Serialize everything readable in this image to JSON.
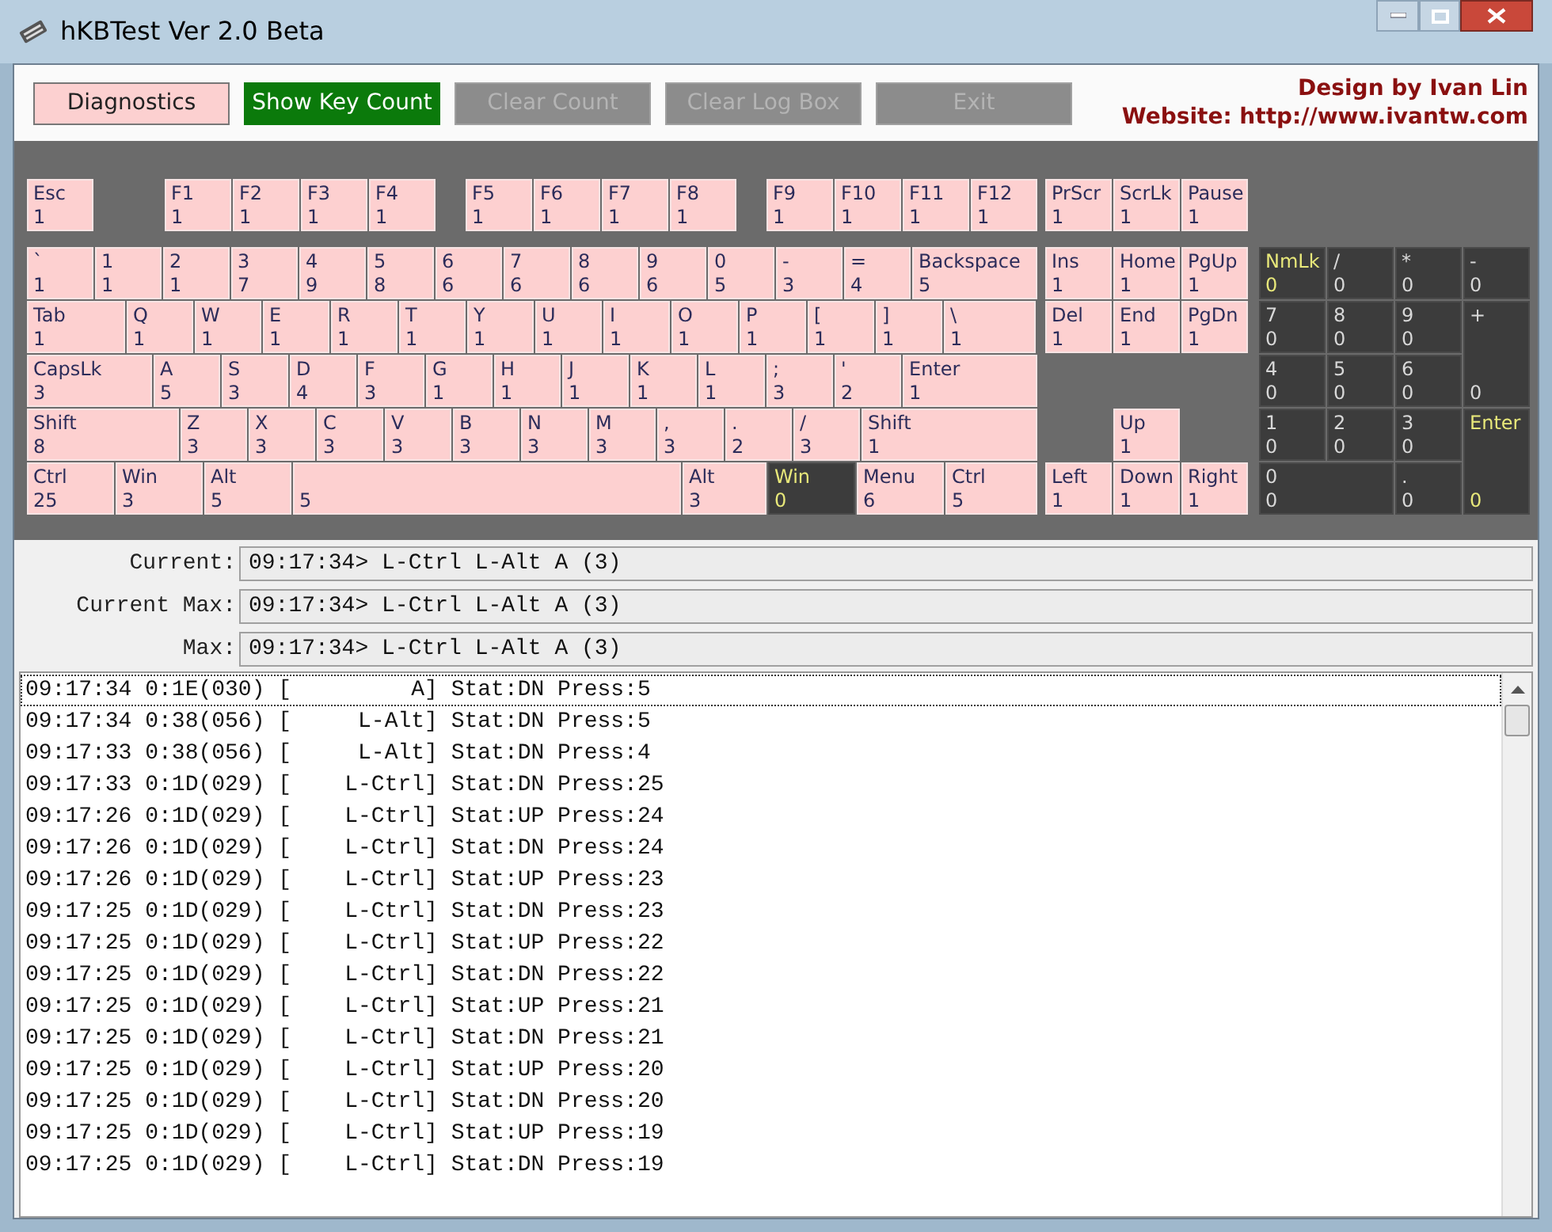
{
  "window": {
    "title": "hKBTest Ver 2.0 Beta"
  },
  "buttons": [
    {
      "label": "Diagnostics",
      "selected": false,
      "disabled": false
    },
    {
      "label": "Show Key Count",
      "selected": true,
      "disabled": false
    },
    {
      "label": "Clear Count",
      "selected": false,
      "disabled": true
    },
    {
      "label": "Clear Log Box",
      "selected": false,
      "disabled": true
    },
    {
      "label": "Exit",
      "selected": false,
      "disabled": true
    }
  ],
  "credits": [
    "Design by Ivan Lin",
    "Website: http://www.ivantw.com"
  ],
  "keyboard": {
    "function_row": [
      {
        "label": "Esc",
        "count": "1",
        "tested": true,
        "accent": false
      },
      {
        "label": "F1",
        "count": "1",
        "tested": true,
        "accent": false
      },
      {
        "label": "F2",
        "count": "1",
        "tested": true,
        "accent": false
      },
      {
        "label": "F3",
        "count": "1",
        "tested": true,
        "accent": false
      },
      {
        "label": "F4",
        "count": "1",
        "tested": true,
        "accent": false
      },
      {
        "label": "F5",
        "count": "1",
        "tested": true,
        "accent": false
      },
      {
        "label": "F6",
        "count": "1",
        "tested": true,
        "accent": false
      },
      {
        "label": "F7",
        "count": "1",
        "tested": true,
        "accent": false
      },
      {
        "label": "F8",
        "count": "1",
        "tested": true,
        "accent": false
      },
      {
        "label": "F9",
        "count": "1",
        "tested": true,
        "accent": false
      },
      {
        "label": "F10",
        "count": "1",
        "tested": true,
        "accent": false
      },
      {
        "label": "F11",
        "count": "1",
        "tested": true,
        "accent": false
      },
      {
        "label": "F12",
        "count": "1",
        "tested": true,
        "accent": false
      }
    ],
    "main_rows": [
      [
        {
          "label": "`",
          "count": "1",
          "tested": true,
          "accent": false
        },
        {
          "label": "1",
          "count": "1",
          "tested": true,
          "accent": false
        },
        {
          "label": "2",
          "count": "1",
          "tested": true,
          "accent": false
        },
        {
          "label": "3",
          "count": "7",
          "tested": true,
          "accent": false
        },
        {
          "label": "4",
          "count": "9",
          "tested": true,
          "accent": false
        },
        {
          "label": "5",
          "count": "8",
          "tested": true,
          "accent": false
        },
        {
          "label": "6",
          "count": "6",
          "tested": true,
          "accent": false
        },
        {
          "label": "7",
          "count": "6",
          "tested": true,
          "accent": false
        },
        {
          "label": "8",
          "count": "6",
          "tested": true,
          "accent": false
        },
        {
          "label": "9",
          "count": "6",
          "tested": true,
          "accent": false
        },
        {
          "label": "0",
          "count": "5",
          "tested": true,
          "accent": false
        },
        {
          "label": "-",
          "count": "3",
          "tested": true,
          "accent": false
        },
        {
          "label": "=",
          "count": "4",
          "tested": true,
          "accent": false
        },
        {
          "label": "Backspace",
          "count": "5",
          "tested": true,
          "accent": false
        }
      ],
      [
        {
          "label": "Tab",
          "count": "1",
          "tested": true,
          "accent": false
        },
        {
          "label": "Q",
          "count": "1",
          "tested": true,
          "accent": false
        },
        {
          "label": "W",
          "count": "1",
          "tested": true,
          "accent": false
        },
        {
          "label": "E",
          "count": "1",
          "tested": true,
          "accent": false
        },
        {
          "label": "R",
          "count": "1",
          "tested": true,
          "accent": false
        },
        {
          "label": "T",
          "count": "1",
          "tested": true,
          "accent": false
        },
        {
          "label": "Y",
          "count": "1",
          "tested": true,
          "accent": false
        },
        {
          "label": "U",
          "count": "1",
          "tested": true,
          "accent": false
        },
        {
          "label": "I",
          "count": "1",
          "tested": true,
          "accent": false
        },
        {
          "label": "O",
          "count": "1",
          "tested": true,
          "accent": false
        },
        {
          "label": "P",
          "count": "1",
          "tested": true,
          "accent": false
        },
        {
          "label": "[",
          "count": "1",
          "tested": true,
          "accent": false
        },
        {
          "label": "]",
          "count": "1",
          "tested": true,
          "accent": false
        },
        {
          "label": "\\",
          "count": "1",
          "tested": true,
          "accent": false
        }
      ],
      [
        {
          "label": "CapsLk",
          "count": "3",
          "tested": true,
          "accent": false
        },
        {
          "label": "A",
          "count": "5",
          "tested": true,
          "accent": false
        },
        {
          "label": "S",
          "count": "3",
          "tested": true,
          "accent": false
        },
        {
          "label": "D",
          "count": "4",
          "tested": true,
          "accent": false
        },
        {
          "label": "F",
          "count": "3",
          "tested": true,
          "accent": false
        },
        {
          "label": "G",
          "count": "1",
          "tested": true,
          "accent": false
        },
        {
          "label": "H",
          "count": "1",
          "tested": true,
          "accent": false
        },
        {
          "label": "J",
          "count": "1",
          "tested": true,
          "accent": false
        },
        {
          "label": "K",
          "count": "1",
          "tested": true,
          "accent": false
        },
        {
          "label": "L",
          "count": "1",
          "tested": true,
          "accent": false
        },
        {
          "label": ";",
          "count": "3",
          "tested": true,
          "accent": false
        },
        {
          "label": "'",
          "count": "2",
          "tested": true,
          "accent": false
        },
        {
          "label": "Enter",
          "count": "1",
          "tested": true,
          "accent": false
        }
      ],
      [
        {
          "label": "Shift",
          "count": "8",
          "tested": true,
          "accent": false
        },
        {
          "label": "Z",
          "count": "3",
          "tested": true,
          "accent": false
        },
        {
          "label": "X",
          "count": "3",
          "tested": true,
          "accent": false
        },
        {
          "label": "C",
          "count": "3",
          "tested": true,
          "accent": false
        },
        {
          "label": "V",
          "count": "3",
          "tested": true,
          "accent": false
        },
        {
          "label": "B",
          "count": "3",
          "tested": true,
          "accent": false
        },
        {
          "label": "N",
          "count": "3",
          "tested": true,
          "accent": false
        },
        {
          "label": "M",
          "count": "3",
          "tested": true,
          "accent": false
        },
        {
          "label": ",",
          "count": "3",
          "tested": true,
          "accent": false
        },
        {
          "label": ".",
          "count": "2",
          "tested": true,
          "accent": false
        },
        {
          "label": "/",
          "count": "3",
          "tested": true,
          "accent": false
        },
        {
          "label": "Shift",
          "count": "1",
          "tested": true,
          "accent": false
        }
      ],
      [
        {
          "label": "Ctrl",
          "count": "25",
          "tested": true,
          "accent": false
        },
        {
          "label": "Win",
          "count": "3",
          "tested": true,
          "accent": false
        },
        {
          "label": "Alt",
          "count": "5",
          "tested": true,
          "accent": false
        },
        {
          "count": "5",
          "tested": true,
          "accent": false
        },
        {
          "label": "Alt",
          "count": "3",
          "tested": true,
          "accent": false
        },
        {
          "label": "Win",
          "count": "0",
          "tested": false,
          "accent": true
        },
        {
          "label": "Menu",
          "count": "6",
          "tested": true,
          "accent": false
        },
        {
          "label": "Ctrl",
          "count": "5",
          "tested": true,
          "accent": false
        }
      ]
    ],
    "system_keys": [
      {
        "label": "PrScr",
        "count": "1",
        "tested": true,
        "accent": false
      },
      {
        "label": "ScrLk",
        "count": "1",
        "tested": true,
        "accent": false
      },
      {
        "label": "Pause",
        "count": "1",
        "tested": true,
        "accent": false
      }
    ],
    "nav_keys": [
      {
        "label": "Ins",
        "count": "1",
        "tested": true,
        "accent": false
      },
      {
        "label": "Home",
        "count": "1",
        "tested": true,
        "accent": false
      },
      {
        "label": "PgUp",
        "count": "1",
        "tested": true,
        "accent": false
      },
      {
        "label": "Del",
        "count": "1",
        "tested": true,
        "accent": false
      },
      {
        "label": "End",
        "count": "1",
        "tested": true,
        "accent": false
      },
      {
        "label": "PgDn",
        "count": "1",
        "tested": true,
        "accent": false
      },
      {
        "label": "Up",
        "count": "1",
        "tested": true,
        "accent": false
      },
      {
        "label": "Left",
        "count": "1",
        "tested": true,
        "accent": false
      },
      {
        "label": "Down",
        "count": "1",
        "tested": true,
        "accent": false
      },
      {
        "label": "Right",
        "count": "1",
        "tested": true,
        "accent": false
      }
    ],
    "numpad_keys": [
      {
        "label": "NmLk",
        "count": "0",
        "tested": false,
        "accent": true
      },
      {
        "label": "/",
        "count": "0",
        "tested": false,
        "accent": false
      },
      {
        "label": "*",
        "count": "0",
        "tested": false,
        "accent": false
      },
      {
        "label": "-",
        "count": "0",
        "tested": false,
        "accent": false
      },
      {
        "label": "7",
        "count": "0",
        "tested": false,
        "accent": false
      },
      {
        "label": "8",
        "count": "0",
        "tested": false,
        "accent": false
      },
      {
        "label": "9",
        "count": "0",
        "tested": false,
        "accent": false
      },
      {
        "label": "4",
        "count": "0",
        "tested": false,
        "accent": false
      },
      {
        "label": "5",
        "count": "0",
        "tested": false,
        "accent": false
      },
      {
        "label": "6",
        "count": "0",
        "tested": false,
        "accent": false
      },
      {
        "label": "+",
        "count": "0",
        "tested": false,
        "accent": false
      },
      {
        "label": "1",
        "count": "0",
        "tested": false,
        "accent": false
      },
      {
        "label": "2",
        "count": "0",
        "tested": false,
        "accent": false
      },
      {
        "label": "3",
        "count": "0",
        "tested": false,
        "accent": false
      },
      {
        "label": "0",
        "count": "0",
        "tested": false,
        "accent": false
      },
      {
        "label": ".",
        "count": "0",
        "tested": false,
        "accent": false
      },
      {
        "label": "Enter",
        "count": "0",
        "tested": false,
        "accent": true
      }
    ]
  },
  "readouts": [
    {
      "label": "Current:",
      "value": "09:17:34> L-Ctrl L-Alt A (3)"
    },
    {
      "label": "Current Max:",
      "value": "09:17:34> L-Ctrl L-Alt A (3)"
    },
    {
      "label": "Max:",
      "value": "09:17:34> L-Ctrl L-Alt A (3)"
    }
  ],
  "log": [
    {
      "text": "09:17:34 0:1E(030) [         A] Stat:DN Press:5",
      "selected": true
    },
    {
      "text": "09:17:34 0:38(056) [     L-Alt] Stat:DN Press:5",
      "selected": false
    },
    {
      "text": "09:17:33 0:38(056) [     L-Alt] Stat:DN Press:4",
      "selected": false
    },
    {
      "text": "09:17:33 0:1D(029) [    L-Ctrl] Stat:DN Press:25",
      "selected": false
    },
    {
      "text": "09:17:26 0:1D(029) [    L-Ctrl] Stat:UP Press:24",
      "selected": false
    },
    {
      "text": "09:17:26 0:1D(029) [    L-Ctrl] Stat:DN Press:24",
      "selected": false
    },
    {
      "text": "09:17:26 0:1D(029) [    L-Ctrl] Stat:UP Press:23",
      "selected": false
    },
    {
      "text": "09:17:25 0:1D(029) [    L-Ctrl] Stat:DN Press:23",
      "selected": false
    },
    {
      "text": "09:17:25 0:1D(029) [    L-Ctrl] Stat:UP Press:22",
      "selected": false
    },
    {
      "text": "09:17:25 0:1D(029) [    L-Ctrl] Stat:DN Press:22",
      "selected": false
    },
    {
      "text": "09:17:25 0:1D(029) [    L-Ctrl] Stat:UP Press:21",
      "selected": false
    },
    {
      "text": "09:17:25 0:1D(029) [    L-Ctrl] Stat:DN Press:21",
      "selected": false
    },
    {
      "text": "09:17:25 0:1D(029) [    L-Ctrl] Stat:UP Press:20",
      "selected": false
    },
    {
      "text": "09:17:25 0:1D(029) [    L-Ctrl] Stat:DN Press:20",
      "selected": false
    },
    {
      "text": "09:17:25 0:1D(029) [    L-Ctrl] Stat:UP Press:19",
      "selected": false
    },
    {
      "text": "09:17:25 0:1D(029) [    L-Ctrl] Stat:DN Press:19",
      "selected": false
    }
  ]
}
